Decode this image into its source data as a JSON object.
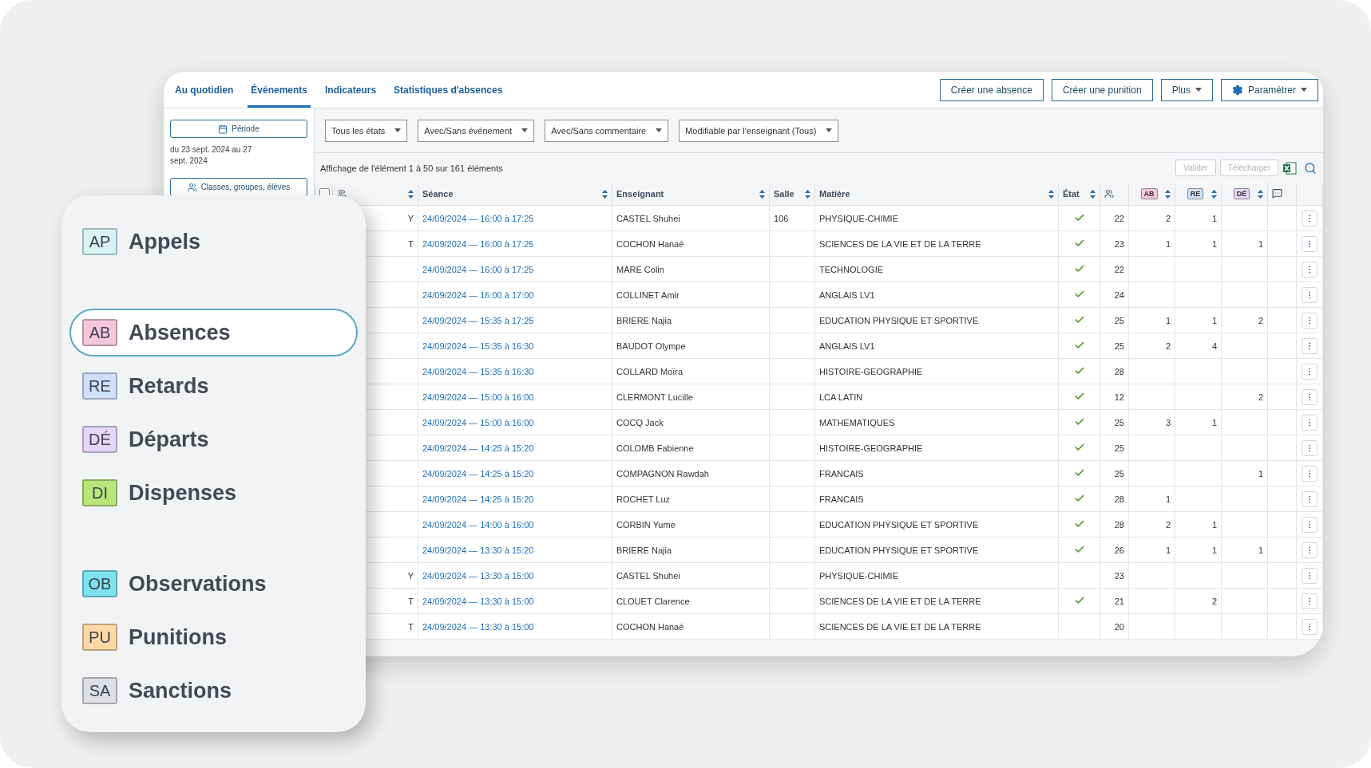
{
  "tabs": [
    {
      "label": "Au quotidien",
      "selected": false
    },
    {
      "label": "Événements",
      "selected": true
    },
    {
      "label": "Indicateurs",
      "selected": false
    },
    {
      "label": "Statistiques d'absences",
      "selected": false
    }
  ],
  "actions": [
    {
      "label": "Créer une absence",
      "kind": "plain"
    },
    {
      "label": "Créer une punition",
      "kind": "plain"
    },
    {
      "label": "Plus",
      "kind": "menu"
    },
    {
      "label": "Paramétrer",
      "kind": "settings"
    }
  ],
  "sidebar": {
    "period_button": "Période",
    "period_text": "du 23 sept. 2024 au 27 sept. 2024",
    "groups_button": "Classes, groupes, élèves"
  },
  "filters": [
    "Tous les états",
    "Avec/Sans événement",
    "Avec/Sans commentaire",
    "Modifiable par l'enseignant (Tous)"
  ],
  "summary": "Affichage de l'élément 1 à 50 sur 161 éléments",
  "table_tools": [
    {
      "label": "Valider",
      "disabled": true
    },
    {
      "label": "Télécharger",
      "disabled": true
    }
  ],
  "table": {
    "select_all_checked": false,
    "columns": [
      {
        "kind": "check"
      },
      {
        "kind": "group"
      },
      {
        "kind": "text",
        "label": "Séance"
      },
      {
        "kind": "text",
        "label": "Enseignant"
      },
      {
        "kind": "text",
        "label": "Salle"
      },
      {
        "kind": "text",
        "label": "Matière"
      },
      {
        "kind": "text",
        "label": "État"
      },
      {
        "kind": "count"
      },
      {
        "kind": "tag",
        "label": "AB",
        "color": "#f7c6dd"
      },
      {
        "kind": "tag",
        "label": "RE",
        "color": "#cfe0fb"
      },
      {
        "kind": "tag",
        "label": "DÉ",
        "color": "#e6d6fb"
      },
      {
        "kind": "comment"
      },
      {
        "kind": "actions"
      }
    ],
    "rows": [
      {
        "group": "Y",
        "seance": "24/09/2024 — 16:00 à 17:25",
        "teacher": "CASTEL Shuhei",
        "room": "106",
        "subject": "PHYSIQUE-CHIMIE",
        "done": true,
        "count": "22",
        "ab": "2",
        "re": "1",
        "de": ""
      },
      {
        "group": "T",
        "seance": "24/09/2024 — 16:00 à 17:25",
        "teacher": "COCHON Hanaé",
        "room": "",
        "subject": "SCIENCES DE LA VIE ET DE LA TERRE",
        "done": true,
        "count": "23",
        "ab": "1",
        "re": "1",
        "de": "1"
      },
      {
        "group": "",
        "seance": "24/09/2024 — 16:00 à 17:25",
        "teacher": "MARE Colin",
        "room": "",
        "subject": "TECHNOLOGIE",
        "done": true,
        "count": "22",
        "ab": "",
        "re": "",
        "de": ""
      },
      {
        "group": "",
        "seance": "24/09/2024 — 16:00 à 17:00",
        "teacher": "COLLINET Amir",
        "room": "",
        "subject": "ANGLAIS LV1",
        "done": true,
        "count": "24",
        "ab": "",
        "re": "",
        "de": ""
      },
      {
        "group": "",
        "seance": "24/09/2024 — 15:35 à 17:25",
        "teacher": "BRIERE Najia",
        "room": "",
        "subject": "EDUCATION PHYSIQUE ET SPORTIVE",
        "done": true,
        "count": "25",
        "ab": "1",
        "re": "1",
        "de": "2"
      },
      {
        "group": "",
        "seance": "24/09/2024 — 15:35 à 16:30",
        "teacher": "BAUDOT Olympe",
        "room": "",
        "subject": "ANGLAIS LV1",
        "done": true,
        "count": "25",
        "ab": "2",
        "re": "4",
        "de": ""
      },
      {
        "group": "",
        "seance": "24/09/2024 — 15:35 à 16:30",
        "teacher": "COLLARD Moïra",
        "room": "",
        "subject": "HISTOIRE-GEOGRAPHIE",
        "done": true,
        "count": "28",
        "ab": "",
        "re": "",
        "de": ""
      },
      {
        "group": "",
        "seance": "24/09/2024 — 15:00 à 16:00",
        "teacher": "CLERMONT Lucille",
        "room": "",
        "subject": "LCA LATIN",
        "done": true,
        "count": "12",
        "ab": "",
        "re": "",
        "de": "2"
      },
      {
        "group": "",
        "seance": "24/09/2024 — 15:00 à 16:00",
        "teacher": "COCQ Jack",
        "room": "",
        "subject": "MATHEMATIQUES",
        "done": true,
        "count": "25",
        "ab": "3",
        "re": "1",
        "de": ""
      },
      {
        "group": "",
        "seance": "24/09/2024 — 14:25 à 15:20",
        "teacher": "COLOMB Fabienne",
        "room": "",
        "subject": "HISTOIRE-GEOGRAPHIE",
        "done": true,
        "count": "25",
        "ab": "",
        "re": "",
        "de": ""
      },
      {
        "group": "",
        "seance": "24/09/2024 — 14:25 à 15:20",
        "teacher": "COMPAGNON Rawdah",
        "room": "",
        "subject": "FRANCAIS",
        "done": true,
        "count": "25",
        "ab": "",
        "re": "",
        "de": "1"
      },
      {
        "group": "",
        "seance": "24/09/2024 — 14:25 à 15:20",
        "teacher": "ROCHET Luz",
        "room": "",
        "subject": "FRANCAIS",
        "done": true,
        "count": "28",
        "ab": "1",
        "re": "",
        "de": ""
      },
      {
        "group": "",
        "seance": "24/09/2024 — 14:00 à 16:00",
        "teacher": "CORBIN Yume",
        "room": "",
        "subject": "EDUCATION PHYSIQUE ET SPORTIVE",
        "done": true,
        "count": "28",
        "ab": "2",
        "re": "1",
        "de": ""
      },
      {
        "group": "",
        "seance": "24/09/2024 — 13:30 à 15:20",
        "teacher": "BRIERE Najia",
        "room": "",
        "subject": "EDUCATION PHYSIQUE ET SPORTIVE",
        "done": true,
        "count": "26",
        "ab": "1",
        "re": "1",
        "de": "1"
      },
      {
        "group": "Y",
        "seance": "24/09/2024 — 13:30 à 15:00",
        "teacher": "CASTEL Shuhei",
        "room": "",
        "subject": "PHYSIQUE-CHIMIE",
        "done": false,
        "count": "23",
        "ab": "",
        "re": "",
        "de": ""
      },
      {
        "group": "T",
        "seance": "24/09/2024 — 13:30 à 15:00",
        "teacher": "CLOUET Clarence",
        "room": "",
        "subject": "SCIENCES DE LA VIE ET DE LA TERRE",
        "done": true,
        "count": "21",
        "ab": "",
        "re": "2",
        "de": ""
      },
      {
        "group": "T",
        "seance": "24/09/2024 — 13:30 à 15:00",
        "teacher": "COCHON Hanaé",
        "room": "",
        "subject": "SCIENCES DE LA VIE ET DE LA TERRE",
        "done": false,
        "count": "20",
        "ab": "",
        "re": "",
        "de": ""
      }
    ]
  },
  "legend": {
    "sections": [
      [
        {
          "code": "AP",
          "label": "Appels",
          "color": "#d8f3f4",
          "selected": false
        }
      ],
      [
        {
          "code": "AB",
          "label": "Absences",
          "color": "#f7c6dd",
          "selected": true
        },
        {
          "code": "RE",
          "label": "Retards",
          "color": "#cfe0fb",
          "selected": false
        },
        {
          "code": "DÉ",
          "label": "Départs",
          "color": "#e6d6fb",
          "selected": false
        },
        {
          "code": "DI",
          "label": "Dispenses",
          "color": "#b9e57a",
          "selected": false
        }
      ],
      [
        {
          "code": "OB",
          "label": "Observations",
          "color": "#7de3ef",
          "selected": false
        },
        {
          "code": "PU",
          "label": "Punitions",
          "color": "#fed9a6",
          "selected": false
        },
        {
          "code": "SA",
          "label": "Sanctions",
          "color": "#dedfe6",
          "selected": false
        }
      ]
    ]
  }
}
